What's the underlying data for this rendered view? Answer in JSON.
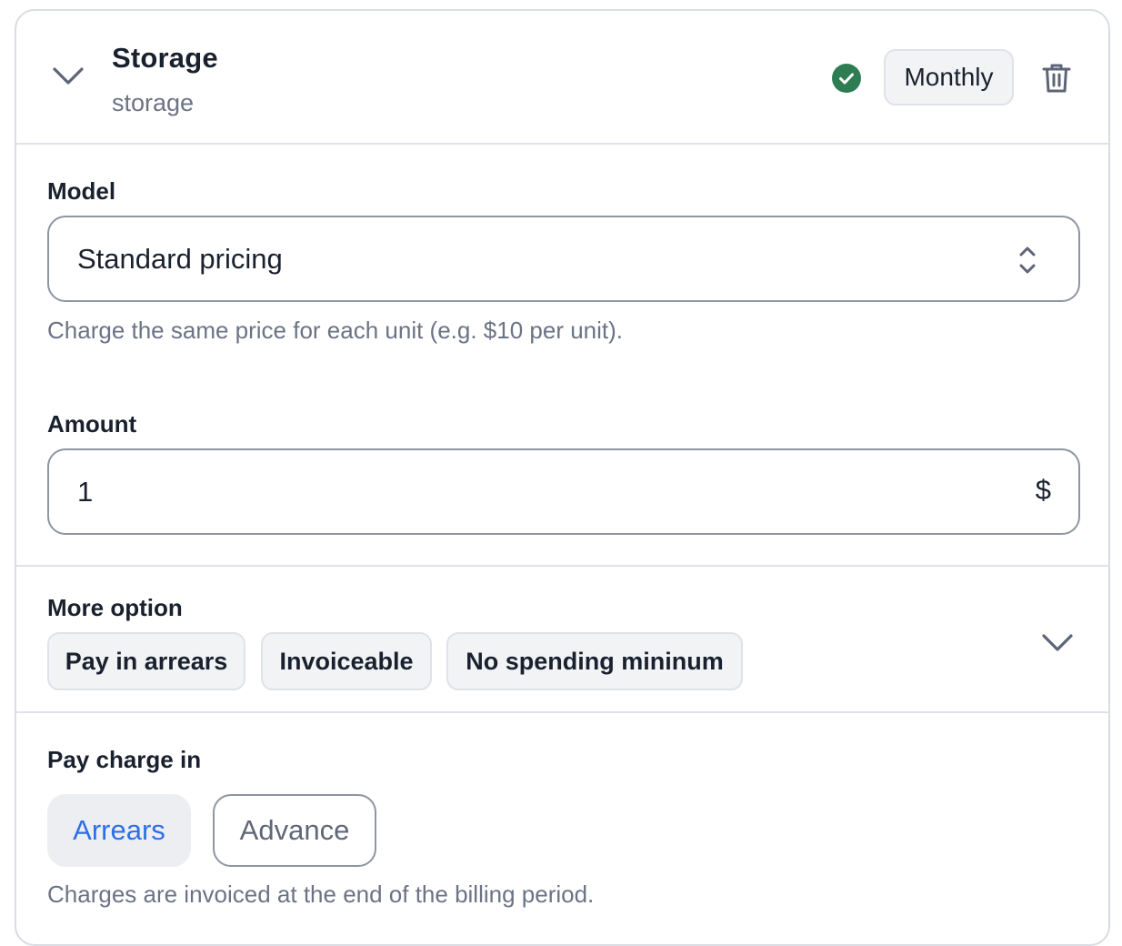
{
  "header": {
    "title": "Storage",
    "code": "storage",
    "status_icon": "check-circle-icon",
    "status_color": "#2e7d52",
    "interval_label": "Monthly",
    "delete_icon": "trash-icon",
    "collapse_icon": "chevron-down-icon"
  },
  "pricing": {
    "model_label": "Model",
    "model_value": "Standard pricing",
    "model_help": "Charge the same price for each unit (e.g. $10 per unit).",
    "amount_label": "Amount",
    "amount_value": "1",
    "amount_currency": "$"
  },
  "more_options": {
    "label": "More option",
    "chips": [
      "Pay in arrears",
      "Invoiceable",
      "No spending mininum"
    ],
    "expand_icon": "chevron-down-icon"
  },
  "pay_charge": {
    "label": "Pay charge in",
    "options": [
      "Arrears",
      "Advance"
    ],
    "selected": "Arrears",
    "help": "Charges are invoiced at the end of the billing period.",
    "accent_color": "#2f6fe4"
  }
}
